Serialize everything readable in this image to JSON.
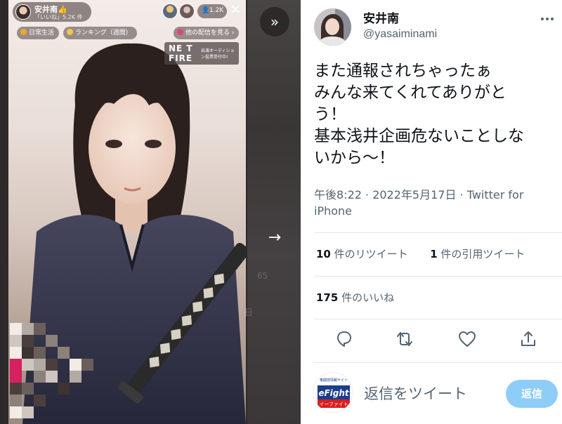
{
  "stream": {
    "streamer_name": "安井南👍",
    "likes_text": "「いいね」5.2K 件",
    "viewer_count": "1.2K",
    "close_symbol": "✕",
    "tags": [
      "日常生活",
      "ランキング（週間）",
      "他の配信を見る ›"
    ],
    "tag_colors": [
      "#f5a623",
      "#f7c548",
      "#e0447a"
    ],
    "banner_line1": "NE  T",
    "banner_line2": "FIRE",
    "banner_sub": "出演オーディション投票受付中!",
    "forward_icon": "»",
    "next_icon": "→",
    "ghost_text": [
      "65",
      "日"
    ]
  },
  "tweet": {
    "display_name": "安井南",
    "handle": "@yasaiminami",
    "text_lines": [
      "また通報されちゃったぁ",
      "みんな来てくれてありがと",
      "う！",
      "基本浅井企画危ないことしな",
      "いから〜！"
    ],
    "timestamp": "午後8:22 · 2022年5月17日 · Twitter for iPhone",
    "retweets_count": "10",
    "retweets_label": " 件のリツイート",
    "quotes_count": "1",
    "quotes_label": " 件の引用ツイート",
    "likes_count": "175",
    "likes_label": " 件のいいね",
    "reply_placeholder": "返信をツイート",
    "reply_button": "返信",
    "logo_top_text": "格闘技情報サイト",
    "logo_main": "eFight",
    "logo_bottom": "イーファイト",
    "accent_color": "#1d9bf0",
    "reply_button_color": "#8ecdf8"
  }
}
